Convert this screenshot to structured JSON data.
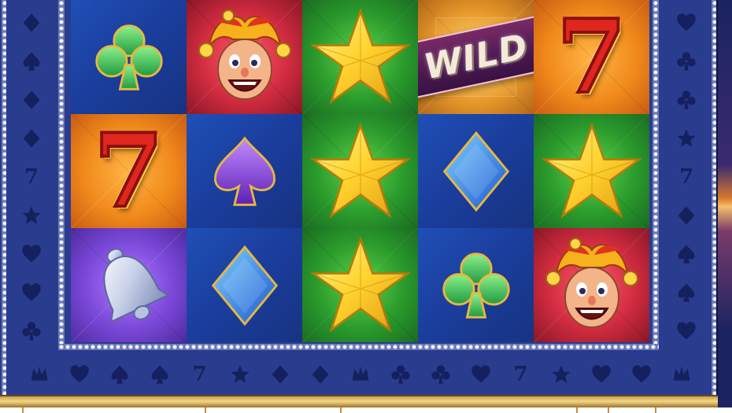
{
  "game": {
    "wild_label": "WILD",
    "seven_label": "7",
    "pattern_seven_label": "7"
  },
  "reels": [
    [
      "club-icon",
      "seven-icon",
      "bell-icon"
    ],
    [
      "jester-icon",
      "spade-icon",
      "diamond-icon"
    ],
    [
      "star-icon",
      "star-icon",
      "star-icon"
    ],
    [
      "wild-icon",
      "diamond-icon",
      "club-icon"
    ],
    [
      "seven-icon",
      "star-icon",
      "jester-icon"
    ]
  ],
  "colors": {
    "frame": "#2a3c8e",
    "pattern": "#15205f",
    "gold": "#f2d684",
    "seven": "#e0261d",
    "star": "#ffd22e",
    "club": "#3cc75a",
    "diamond": "#2d8cff",
    "spade": "#8b3bd8"
  }
}
